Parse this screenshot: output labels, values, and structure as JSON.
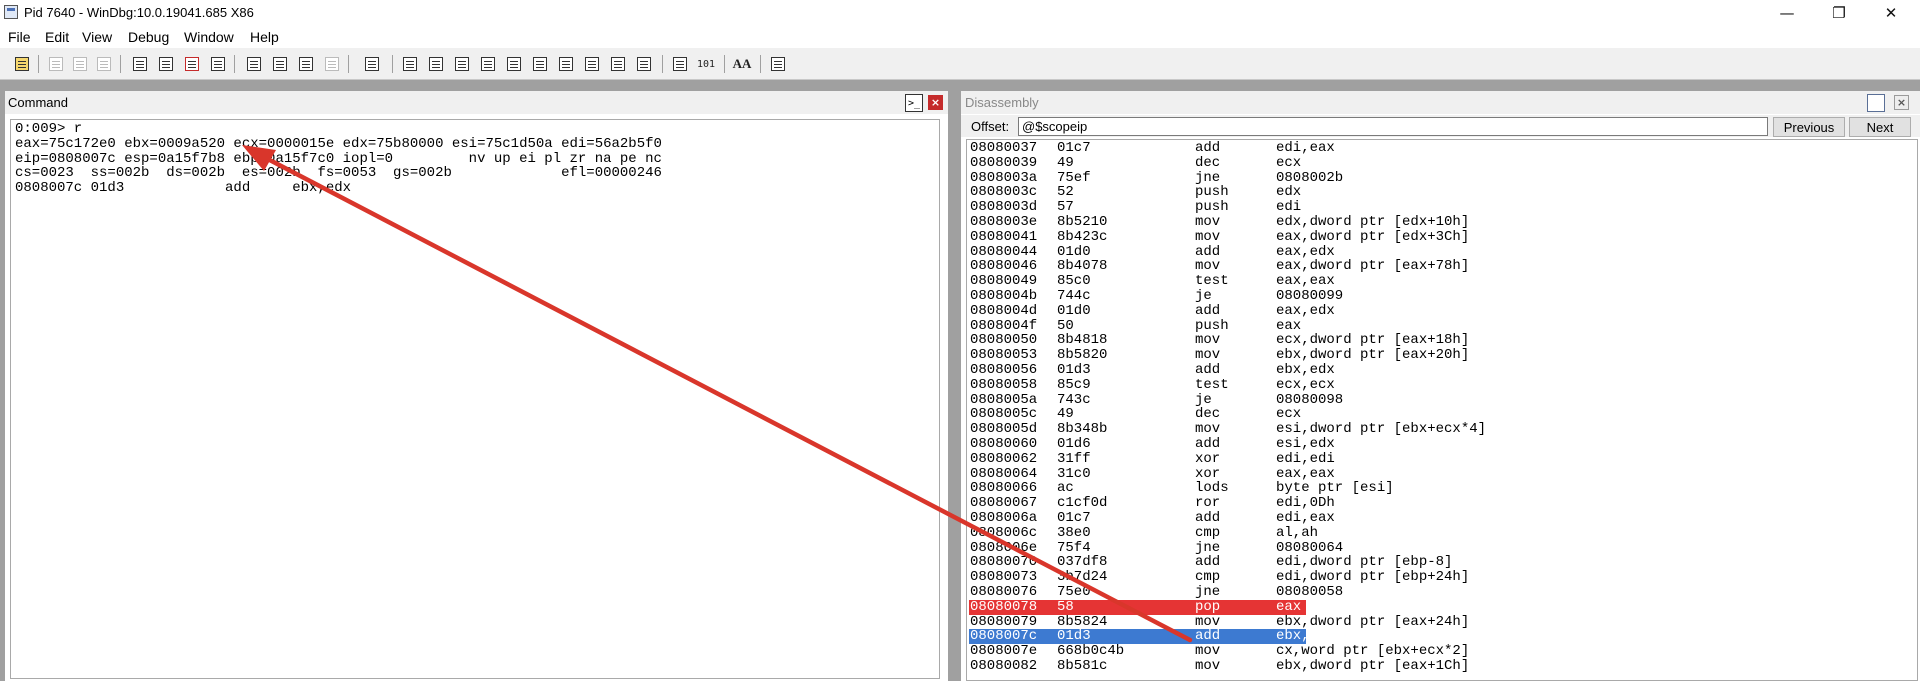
{
  "window": {
    "title": "Pid 7640 - WinDbg:10.0.19041.685 X86",
    "minimize_glyph": "—",
    "restore_glyph": "❐",
    "close_glyph": "✕"
  },
  "menu": [
    "File",
    "Edit",
    "View",
    "Debug",
    "Window",
    "Help"
  ],
  "toolbar": {
    "font_button_label": "AA",
    "radix_button_label": "101"
  },
  "command": {
    "title": "Command",
    "close_glyph": "×",
    "output": "0:009> r\neax=75c172e0 ebx=0009a520 ecx=0000015e edx=75b80000 esi=75c1d50a edi=56a2b5f0\neip=0808007c esp=0a15f7b8 ebp=0a15f7c0 iopl=0         nv up ei pl zr na pe nc\ncs=0023  ss=002b  ds=002b  es=002b  fs=0053  gs=002b             efl=00000246\n0808007c 01d3            add     ebx,edx"
  },
  "disassembly": {
    "title": "Disassembly",
    "close_glyph": "×",
    "offset_label": "Offset:",
    "offset_value": "@$scopeip",
    "previous_label": "Previous",
    "next_label": "Next",
    "rows": [
      {
        "addr": "08080037",
        "bytes": "01c7",
        "mnemonic": "add",
        "operands": "edi,eax"
      },
      {
        "addr": "08080039",
        "bytes": "49",
        "mnemonic": "dec",
        "operands": "ecx"
      },
      {
        "addr": "0808003a",
        "bytes": "75ef",
        "mnemonic": "jne",
        "operands": "0808002b"
      },
      {
        "addr": "0808003c",
        "bytes": "52",
        "mnemonic": "push",
        "operands": "edx"
      },
      {
        "addr": "0808003d",
        "bytes": "57",
        "mnemonic": "push",
        "operands": "edi"
      },
      {
        "addr": "0808003e",
        "bytes": "8b5210",
        "mnemonic": "mov",
        "operands": "edx,dword ptr [edx+10h]"
      },
      {
        "addr": "08080041",
        "bytes": "8b423c",
        "mnemonic": "mov",
        "operands": "eax,dword ptr [edx+3Ch]"
      },
      {
        "addr": "08080044",
        "bytes": "01d0",
        "mnemonic": "add",
        "operands": "eax,edx"
      },
      {
        "addr": "08080046",
        "bytes": "8b4078",
        "mnemonic": "mov",
        "operands": "eax,dword ptr [eax+78h]"
      },
      {
        "addr": "08080049",
        "bytes": "85c0",
        "mnemonic": "test",
        "operands": "eax,eax"
      },
      {
        "addr": "0808004b",
        "bytes": "744c",
        "mnemonic": "je",
        "operands": "08080099"
      },
      {
        "addr": "0808004d",
        "bytes": "01d0",
        "mnemonic": "add",
        "operands": "eax,edx"
      },
      {
        "addr": "0808004f",
        "bytes": "50",
        "mnemonic": "push",
        "operands": "eax"
      },
      {
        "addr": "08080050",
        "bytes": "8b4818",
        "mnemonic": "mov",
        "operands": "ecx,dword ptr [eax+18h]"
      },
      {
        "addr": "08080053",
        "bytes": "8b5820",
        "mnemonic": "mov",
        "operands": "ebx,dword ptr [eax+20h]"
      },
      {
        "addr": "08080056",
        "bytes": "01d3",
        "mnemonic": "add",
        "operands": "ebx,edx"
      },
      {
        "addr": "08080058",
        "bytes": "85c9",
        "mnemonic": "test",
        "operands": "ecx,ecx"
      },
      {
        "addr": "0808005a",
        "bytes": "743c",
        "mnemonic": "je",
        "operands": "08080098"
      },
      {
        "addr": "0808005c",
        "bytes": "49",
        "mnemonic": "dec",
        "operands": "ecx"
      },
      {
        "addr": "0808005d",
        "bytes": "8b348b",
        "mnemonic": "mov",
        "operands": "esi,dword ptr [ebx+ecx*4]"
      },
      {
        "addr": "08080060",
        "bytes": "01d6",
        "mnemonic": "add",
        "operands": "esi,edx"
      },
      {
        "addr": "08080062",
        "bytes": "31ff",
        "mnemonic": "xor",
        "operands": "edi,edi"
      },
      {
        "addr": "08080064",
        "bytes": "31c0",
        "mnemonic": "xor",
        "operands": "eax,eax"
      },
      {
        "addr": "08080066",
        "bytes": "ac",
        "mnemonic": "lods",
        "operands": "byte ptr [esi]"
      },
      {
        "addr": "08080067",
        "bytes": "c1cf0d",
        "mnemonic": "ror",
        "operands": "edi,0Dh"
      },
      {
        "addr": "0808006a",
        "bytes": "01c7",
        "mnemonic": "add",
        "operands": "edi,eax"
      },
      {
        "addr": "0808006c",
        "bytes": "38e0",
        "mnemonic": "cmp",
        "operands": "al,ah"
      },
      {
        "addr": "0808006e",
        "bytes": "75f4",
        "mnemonic": "jne",
        "operands": "08080064"
      },
      {
        "addr": "08080070",
        "bytes": "037df8",
        "mnemonic": "add",
        "operands": "edi,dword ptr [ebp-8]"
      },
      {
        "addr": "08080073",
        "bytes": "3b7d24",
        "mnemonic": "cmp",
        "operands": "edi,dword ptr [ebp+24h]"
      },
      {
        "addr": "08080076",
        "bytes": "75e0",
        "mnemonic": "jne",
        "operands": "08080058"
      },
      {
        "addr": "08080078",
        "bytes": "58",
        "mnemonic": "pop",
        "operands": "eax",
        "highlight": "breakpoint"
      },
      {
        "addr": "08080079",
        "bytes": "8b5824",
        "mnemonic": "mov",
        "operands": "ebx,dword ptr [eax+24h]"
      },
      {
        "addr": "0808007c",
        "bytes": "01d3",
        "mnemonic": "add",
        "operands": "ebx,edx",
        "highlight": "current"
      },
      {
        "addr": "0808007e",
        "bytes": "668b0c4b",
        "mnemonic": "mov",
        "operands": "cx,word ptr [ebx+ecx*2]"
      },
      {
        "addr": "08080082",
        "bytes": "8b581c",
        "mnemonic": "mov",
        "operands": "ebx,dword ptr [eax+1Ch]"
      }
    ]
  },
  "colors": {
    "breakpoint_line": "#e53434",
    "current_line": "#3d7ad1",
    "arrow": "#d9362b"
  }
}
